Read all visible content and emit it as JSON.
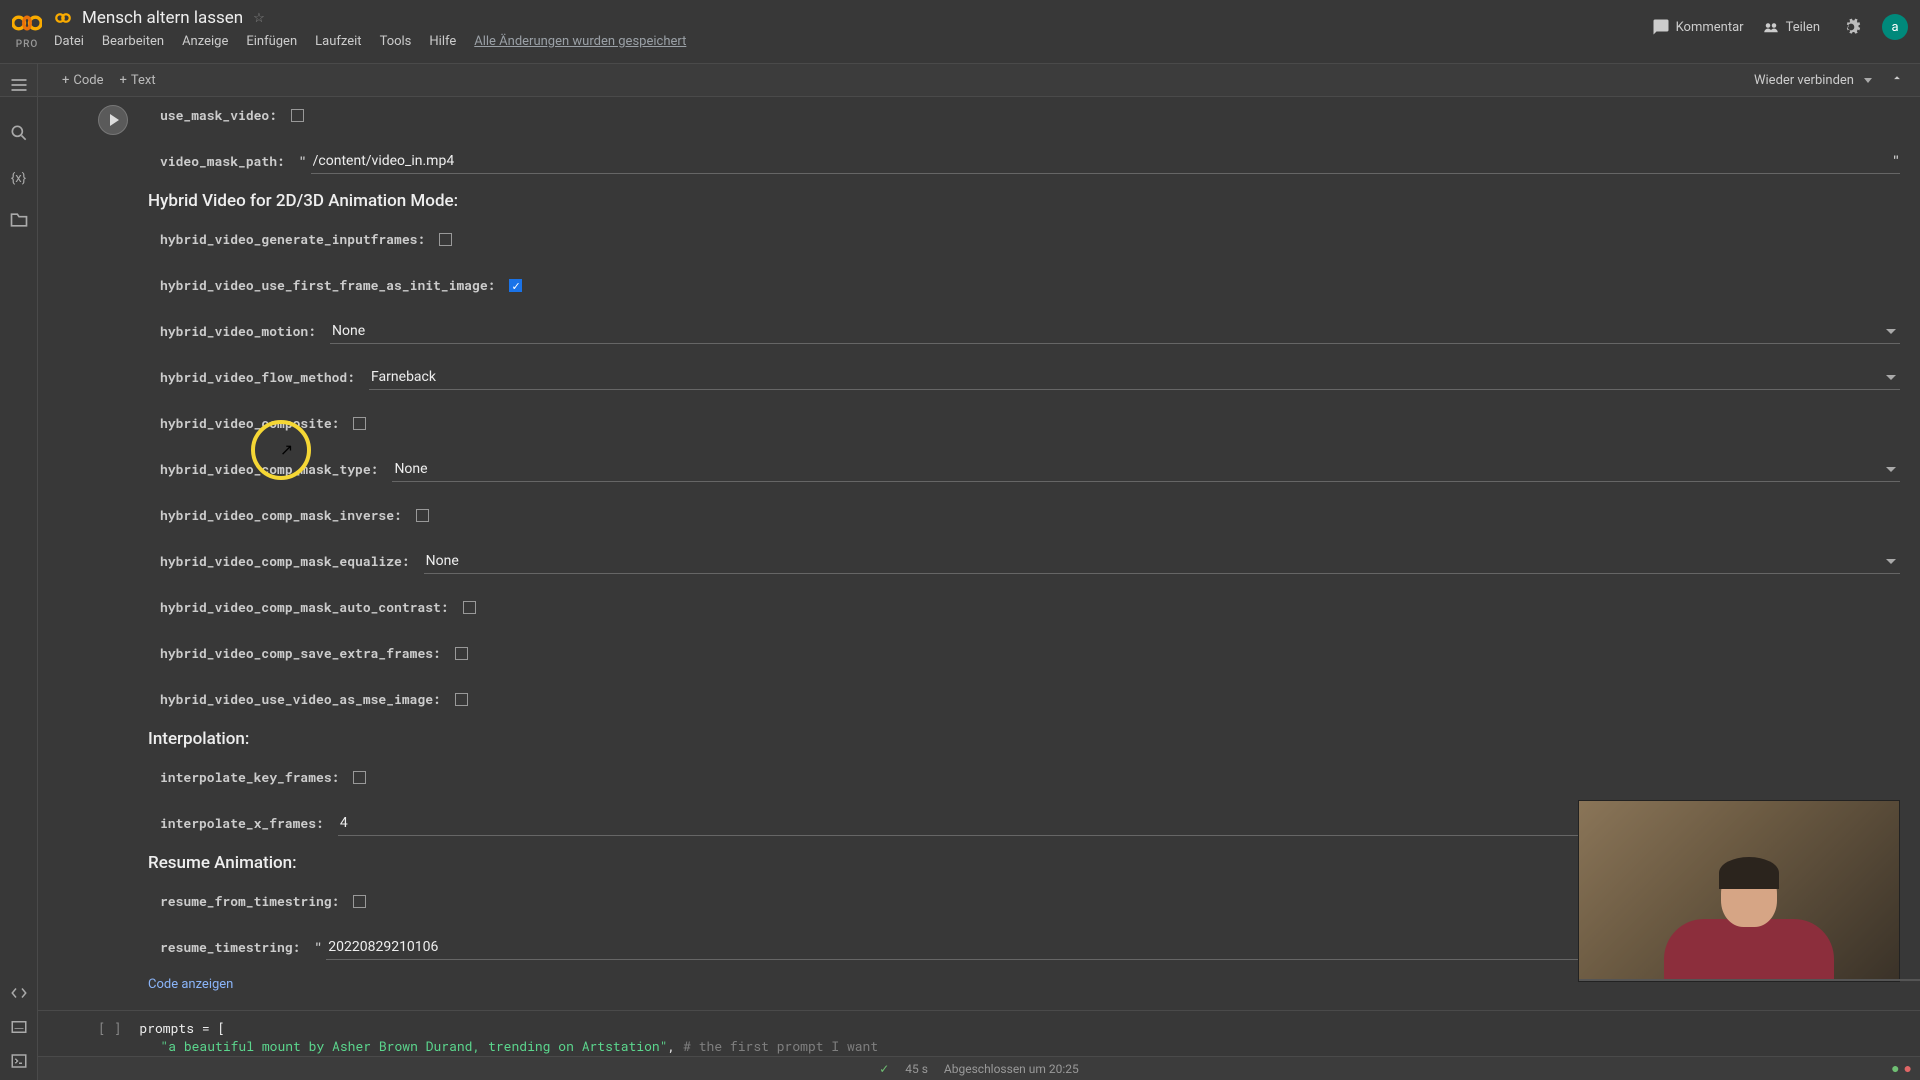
{
  "header": {
    "pro": "PRO",
    "title": "Mensch altern lassen",
    "menus": {
      "datei": "Datei",
      "bearbeiten": "Bearbeiten",
      "anzeige": "Anzeige",
      "einfuegen": "Einfügen",
      "laufzeit": "Laufzeit",
      "tools": "Tools",
      "hilfe": "Hilfe"
    },
    "saved": "Alle Änderungen wurden gespeichert",
    "kommentar": "Kommentar",
    "teilen": "Teilen",
    "avatar": "a"
  },
  "toolbar": {
    "code": "Code",
    "text": "Text",
    "reconnect": "Wieder verbinden"
  },
  "form": {
    "use_mask_video": {
      "label": "use_mask_video:",
      "checked": false
    },
    "video_mask_path": {
      "label": "video_mask_path:",
      "value": "/content/video_in.mp4"
    },
    "section_hybrid": "Hybrid Video for 2D/3D Animation Mode:",
    "hybrid_video_generate_inputframes": {
      "label": "hybrid_video_generate_inputframes:",
      "checked": false
    },
    "hybrid_video_use_first_frame_as_init_image": {
      "label": "hybrid_video_use_first_frame_as_init_image:",
      "checked": true
    },
    "hybrid_video_motion": {
      "label": "hybrid_video_motion:",
      "value": "None"
    },
    "hybrid_video_flow_method": {
      "label": "hybrid_video_flow_method:",
      "value": "Farneback"
    },
    "hybrid_video_composite": {
      "label": "hybrid_video_composite:",
      "checked": false
    },
    "hybrid_video_comp_mask_type": {
      "label": "hybrid_video_comp_mask_type:",
      "value": "None"
    },
    "hybrid_video_comp_mask_inverse": {
      "label": "hybrid_video_comp_mask_inverse:",
      "checked": false
    },
    "hybrid_video_comp_mask_equalize": {
      "label": "hybrid_video_comp_mask_equalize:",
      "value": "None"
    },
    "hybrid_video_comp_mask_auto_contrast": {
      "label": "hybrid_video_comp_mask_auto_contrast:",
      "checked": false
    },
    "hybrid_video_comp_save_extra_frames": {
      "label": "hybrid_video_comp_save_extra_frames:",
      "checked": false
    },
    "hybrid_video_use_video_as_mse_image": {
      "label": "hybrid_video_use_video_as_mse_image:",
      "checked": false
    },
    "section_interp": "Interpolation:",
    "interpolate_key_frames": {
      "label": "interpolate_key_frames:",
      "checked": false
    },
    "interpolate_x_frames": {
      "label": "interpolate_x_frames:",
      "value": "4"
    },
    "section_resume": "Resume Animation:",
    "resume_from_timestring": {
      "label": "resume_from_timestring:",
      "checked": false
    },
    "resume_timestring": {
      "label": "resume_timestring:",
      "value": "20220829210106"
    },
    "show_code": "Code anzeigen"
  },
  "code_cell": {
    "gutter": "[ ]",
    "line1": "prompts = [",
    "line2_str": "\"a beautiful mount by Asher Brown Durand, trending on Artstation\"",
    "line2_comma": ", ",
    "line2_comment": "# the first prompt I want"
  },
  "status": {
    "check": "✓",
    "time": "45 s",
    "done": "Abgeschlossen um 20:25"
  }
}
